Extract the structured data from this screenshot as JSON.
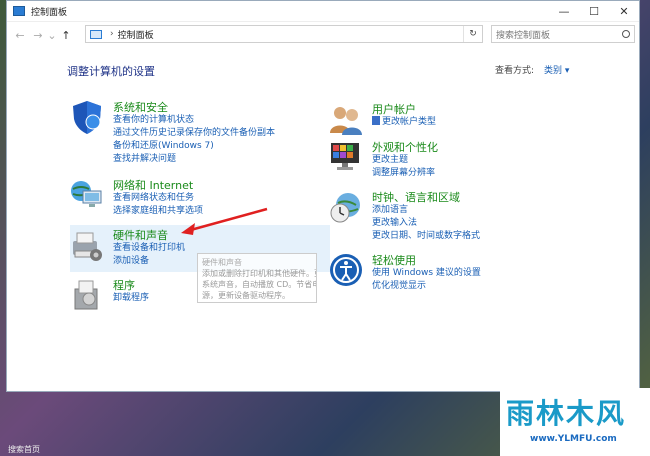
{
  "window": {
    "title": "控制面板",
    "controls": [
      "—",
      "☐",
      "✕"
    ]
  },
  "navbar": {
    "back": "←",
    "forward": "→",
    "recent": "⌄",
    "up": "↑",
    "breadcrumb_sep": "›",
    "breadcrumb": "控制面板",
    "refresh": "↻",
    "search_placeholder": "搜索控制面板"
  },
  "heading": "调整计算机的设置",
  "view_by": {
    "label": "查看方式:",
    "value": "类别 ▾"
  },
  "categories_left": [
    {
      "title": "系统和安全",
      "links": [
        "查看你的计算机状态",
        "通过文件历史记录保存你的文件备份副本",
        "备份和还原(Windows 7)",
        "查找并解决问题"
      ]
    },
    {
      "title": "网络和 Internet",
      "links": [
        "查看网络状态和任务",
        "选择家庭组和共享选项"
      ]
    },
    {
      "title": "硬件和声音",
      "links": [
        "查看设备和打印机",
        "添加设备"
      ]
    },
    {
      "title": "程序",
      "links": [
        "卸载程序"
      ]
    }
  ],
  "categories_right": [
    {
      "title": "用户帐户",
      "links": [
        "更改帐户类型"
      ]
    },
    {
      "title": "外观和个性化",
      "links": [
        "更改主题",
        "调整屏幕分辨率"
      ]
    },
    {
      "title": "时钟、语言和区域",
      "links": [
        "添加语言",
        "更改输入法",
        "更改日期、时间或数字格式"
      ]
    },
    {
      "title": "轻松使用",
      "links": [
        "使用 Windows 建议的设置",
        "优化视觉显示"
      ]
    }
  ],
  "tooltip": {
    "lines": [
      "硬件和声音",
      "添加或删除打印机和其他硬件。更改",
      "系统声音，自动播放 CD。节省电",
      "源，更新设备驱动程序。"
    ]
  },
  "watermark": {
    "logo": "雨林木风",
    "url": "www.YLMFU.com"
  },
  "taskbar_fragment": "搜索首页"
}
